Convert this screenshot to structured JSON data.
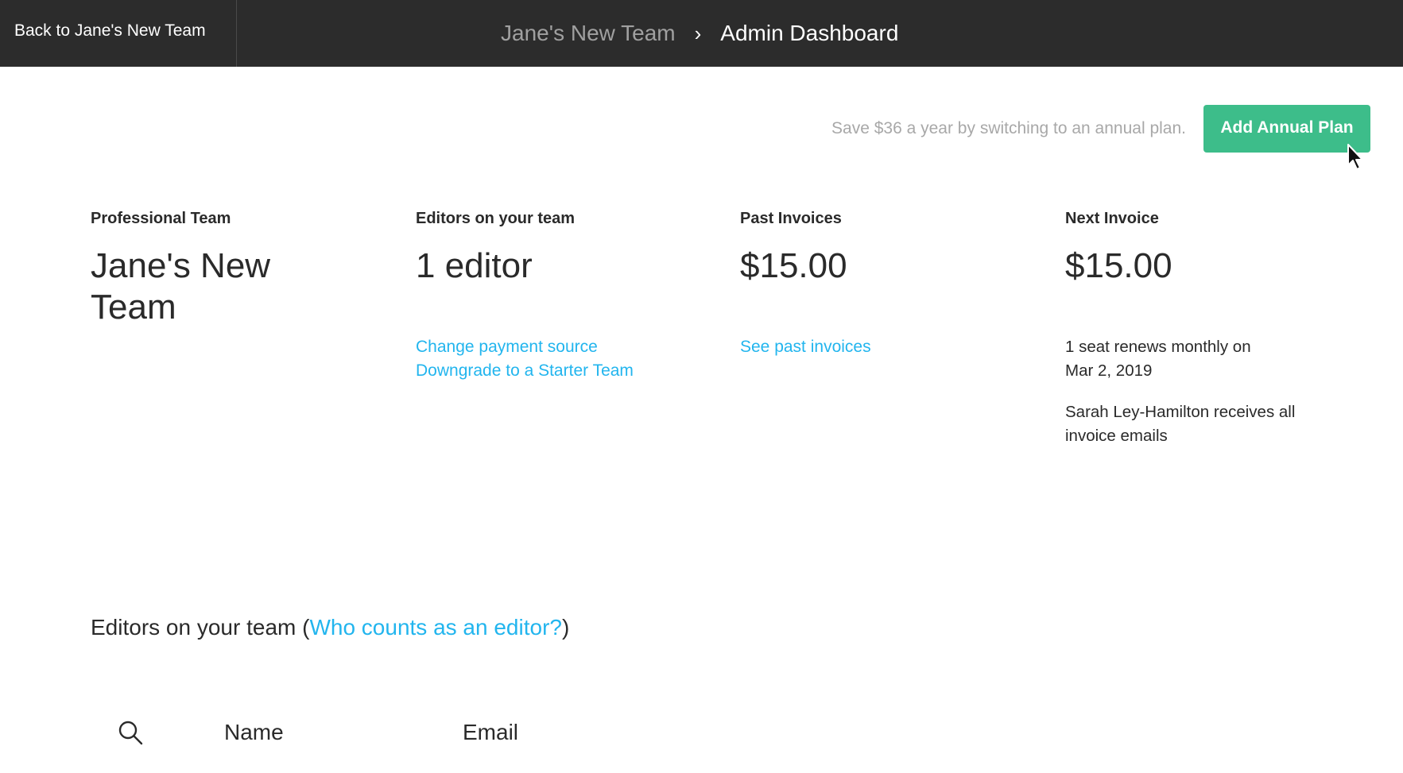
{
  "topbar": {
    "back_label": "Back to Jane's New Team",
    "breadcrumb_team": "Jane's New Team",
    "breadcrumb_separator": "›",
    "breadcrumb_current": "Admin Dashboard"
  },
  "promo": {
    "text": "Save $36 a year by switching to an annual plan.",
    "button_label": "Add Annual Plan"
  },
  "summary": {
    "plan": {
      "label": "Professional Team",
      "value": "Jane's New Team"
    },
    "editors": {
      "label": "Editors on your team",
      "value": "1 editor",
      "links": [
        "Change payment source",
        "Downgrade to a Starter Team"
      ]
    },
    "past_invoices": {
      "label": "Past Invoices",
      "value": "$15.00",
      "link": "See past invoices"
    },
    "next_invoice": {
      "label": "Next Invoice",
      "value": "$15.00",
      "renewal": "1 seat renews monthly on Mar 2, 2019",
      "recipient": "Sarah Ley-Hamilton receives all invoice emails"
    }
  },
  "editors_section": {
    "heading_prefix": "Editors on your team (",
    "heading_link": "Who counts as an editor?",
    "heading_suffix": ")",
    "columns": [
      "Name",
      "Email"
    ]
  },
  "colors": {
    "topbar": "#2c2c2c",
    "accent_button": "#3dbd8a",
    "link": "#22b5ee"
  },
  "icons": {
    "search": "search-icon",
    "cursor": "mouse-pointer-icon"
  }
}
